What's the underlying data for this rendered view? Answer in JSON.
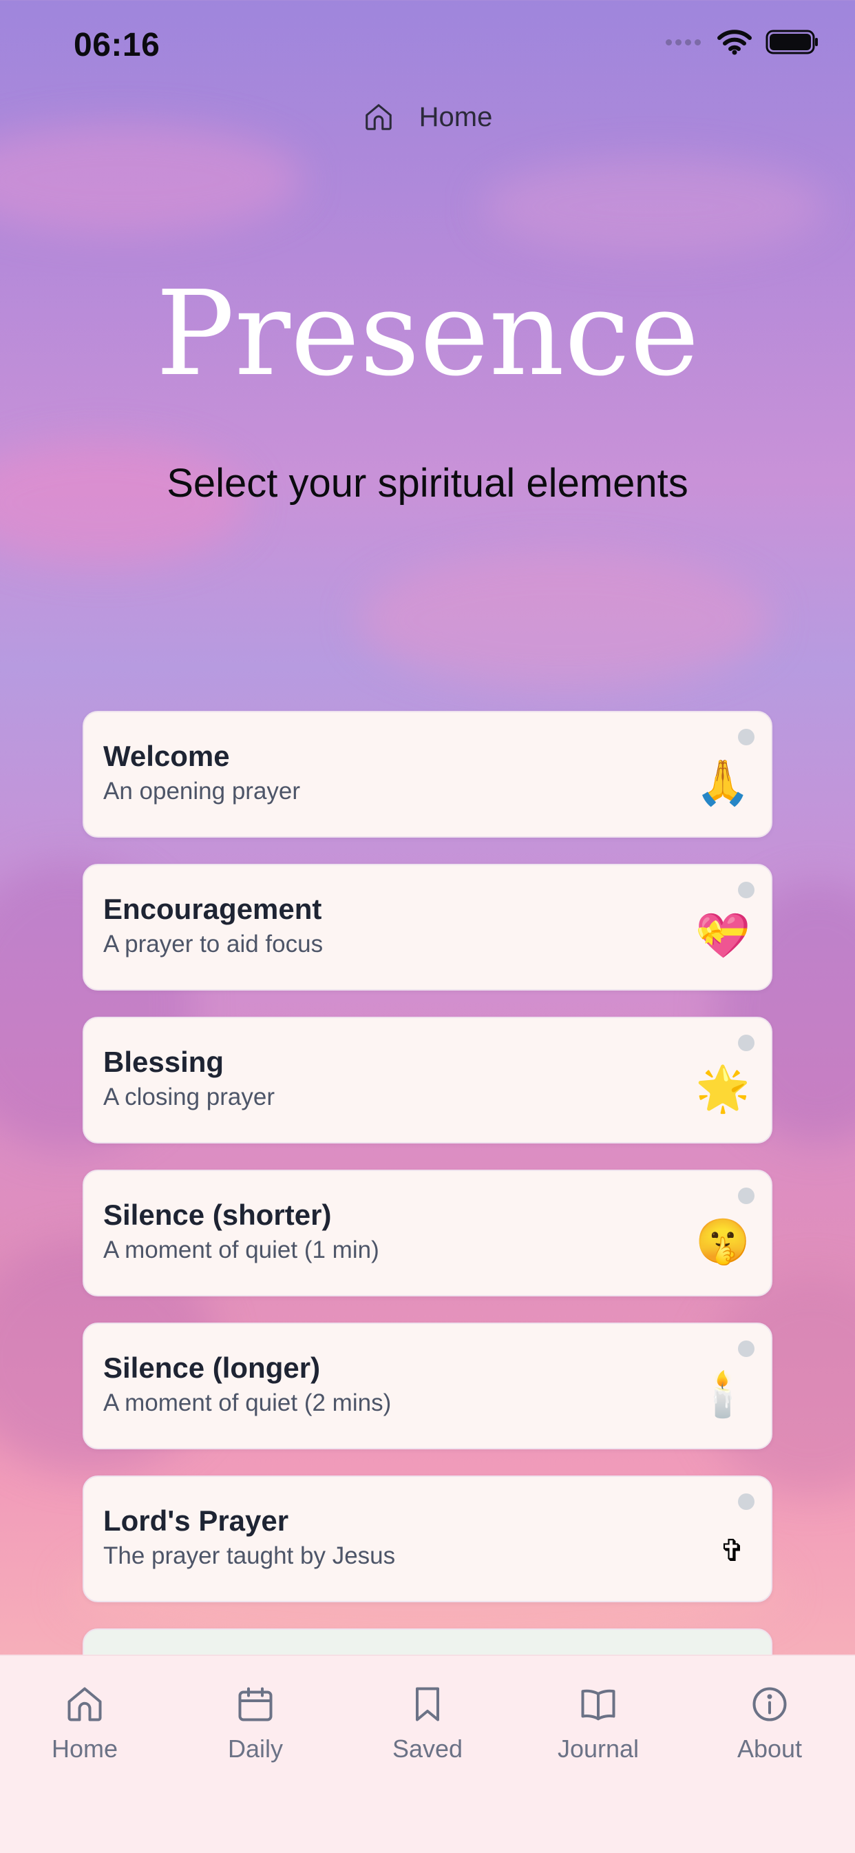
{
  "status_bar": {
    "time": "06:16"
  },
  "top_nav": {
    "icon": "home-icon",
    "label": "Home"
  },
  "header": {
    "title": "Presence",
    "subtitle": "Select your spiritual elements"
  },
  "elements": [
    {
      "title": "Welcome",
      "description": "An opening prayer",
      "emoji": "🙏"
    },
    {
      "title": "Encouragement",
      "description": "A prayer to aid focus",
      "emoji": "💝"
    },
    {
      "title": "Blessing",
      "description": "A closing prayer",
      "emoji": "🌟"
    },
    {
      "title": "Silence (shorter)",
      "description": "A moment of quiet (1 min)",
      "emoji": "🤫"
    },
    {
      "title": "Silence (longer)",
      "description": "A moment of quiet (2 mins)",
      "emoji": "🕯️"
    },
    {
      "title": "Lord's Prayer",
      "description": "The prayer taught by Jesus",
      "emoji": "✞"
    }
  ],
  "tab_bar": {
    "items": [
      {
        "label": "Home",
        "icon": "home-icon"
      },
      {
        "label": "Daily",
        "icon": "calendar-icon"
      },
      {
        "label": "Saved",
        "icon": "bookmark-icon"
      },
      {
        "label": "Journal",
        "icon": "book-icon"
      },
      {
        "label": "About",
        "icon": "info-icon"
      }
    ]
  },
  "colors": {
    "card_bg": "#fdf5f3",
    "title_text": "#1e2433",
    "tab_text": "#6b7286",
    "tab_bar_bg": "#fdecef"
  }
}
